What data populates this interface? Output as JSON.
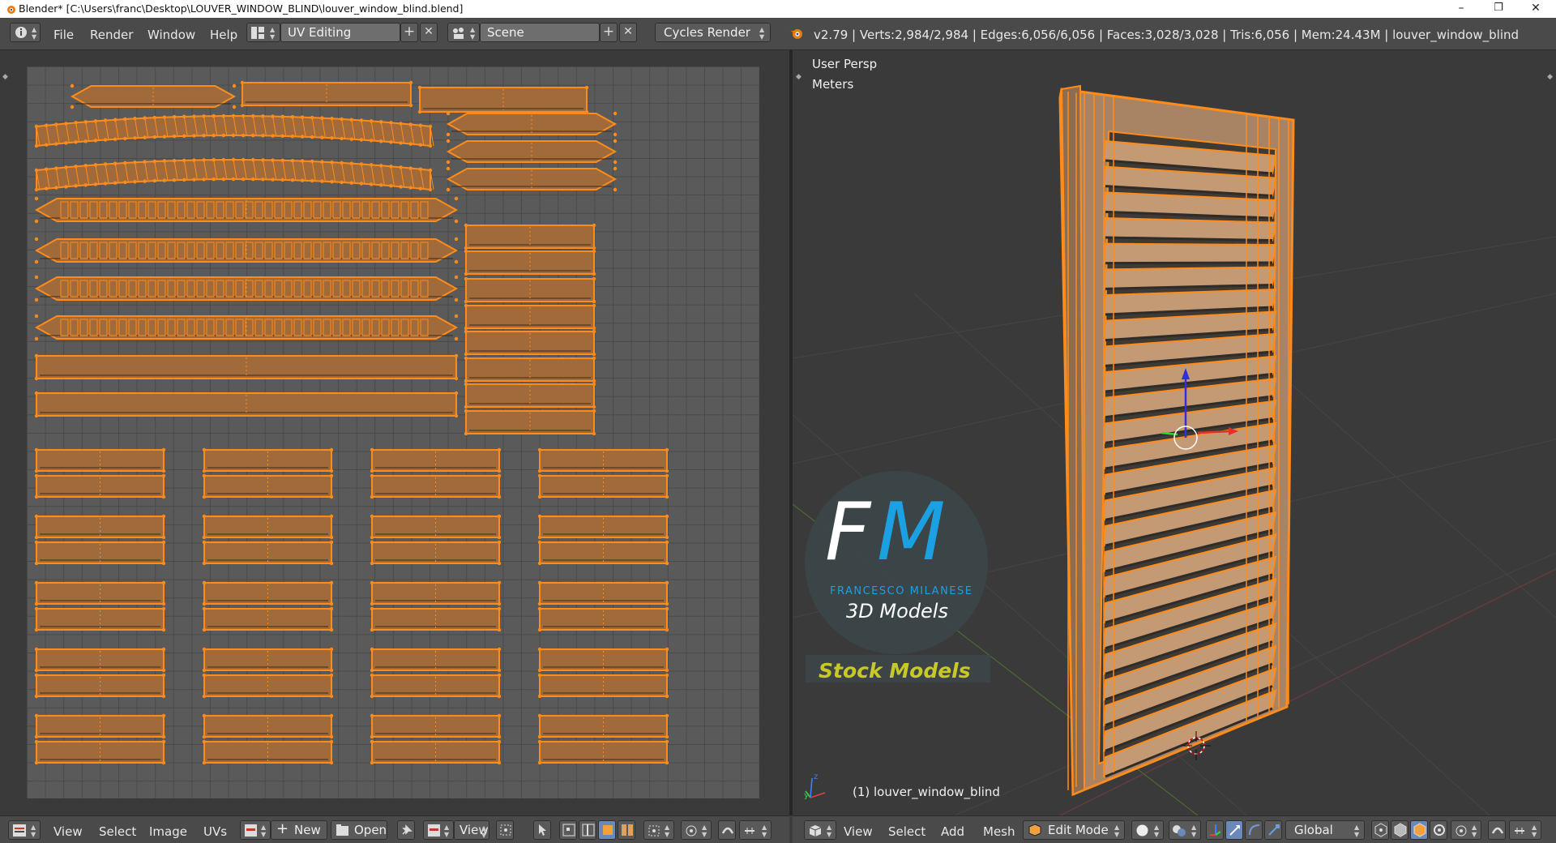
{
  "window": {
    "title": "Blender* [C:\\Users\\franc\\Desktop\\LOUVER_WINDOW_BLIND\\louver_window_blind.blend]",
    "minimize": "–",
    "maximize": "❐",
    "close": "✕"
  },
  "menu": [
    "File",
    "Render",
    "Window",
    "Help"
  ],
  "screen_layout": "UV Editing",
  "scene": "Scene",
  "render_engine": "Cycles Render",
  "stats": "v2.79 | Verts:2,984/2,984 | Edges:6,056/6,056 | Faces:3,028/3,028 | Tris:6,056 | Mem:24.43M | louver_window_blind",
  "uv_editor": {
    "menu": [
      "View",
      "Select",
      "Image",
      "UVs"
    ],
    "new_label": "New",
    "open_label": "Open",
    "view_label": "View"
  },
  "viewport": {
    "view_label": "User Persp",
    "units_label": "Meters",
    "object_label": "(1) louver_window_blind",
    "menu": [
      "View",
      "Select",
      "Add",
      "Mesh"
    ],
    "mode": "Edit Mode",
    "orientation": "Global"
  },
  "watermark": {
    "letters_f": "F",
    "letters_m": "M",
    "name": "FRANCESCO MILANESE",
    "tagline": "3D Models",
    "stock": "Stock Models"
  },
  "colors": {
    "selection": "#ff8c1a",
    "island_fill": "#a06a3a",
    "accent_blue": "#1ba1e2",
    "stock_yellow": "#c8c826"
  }
}
